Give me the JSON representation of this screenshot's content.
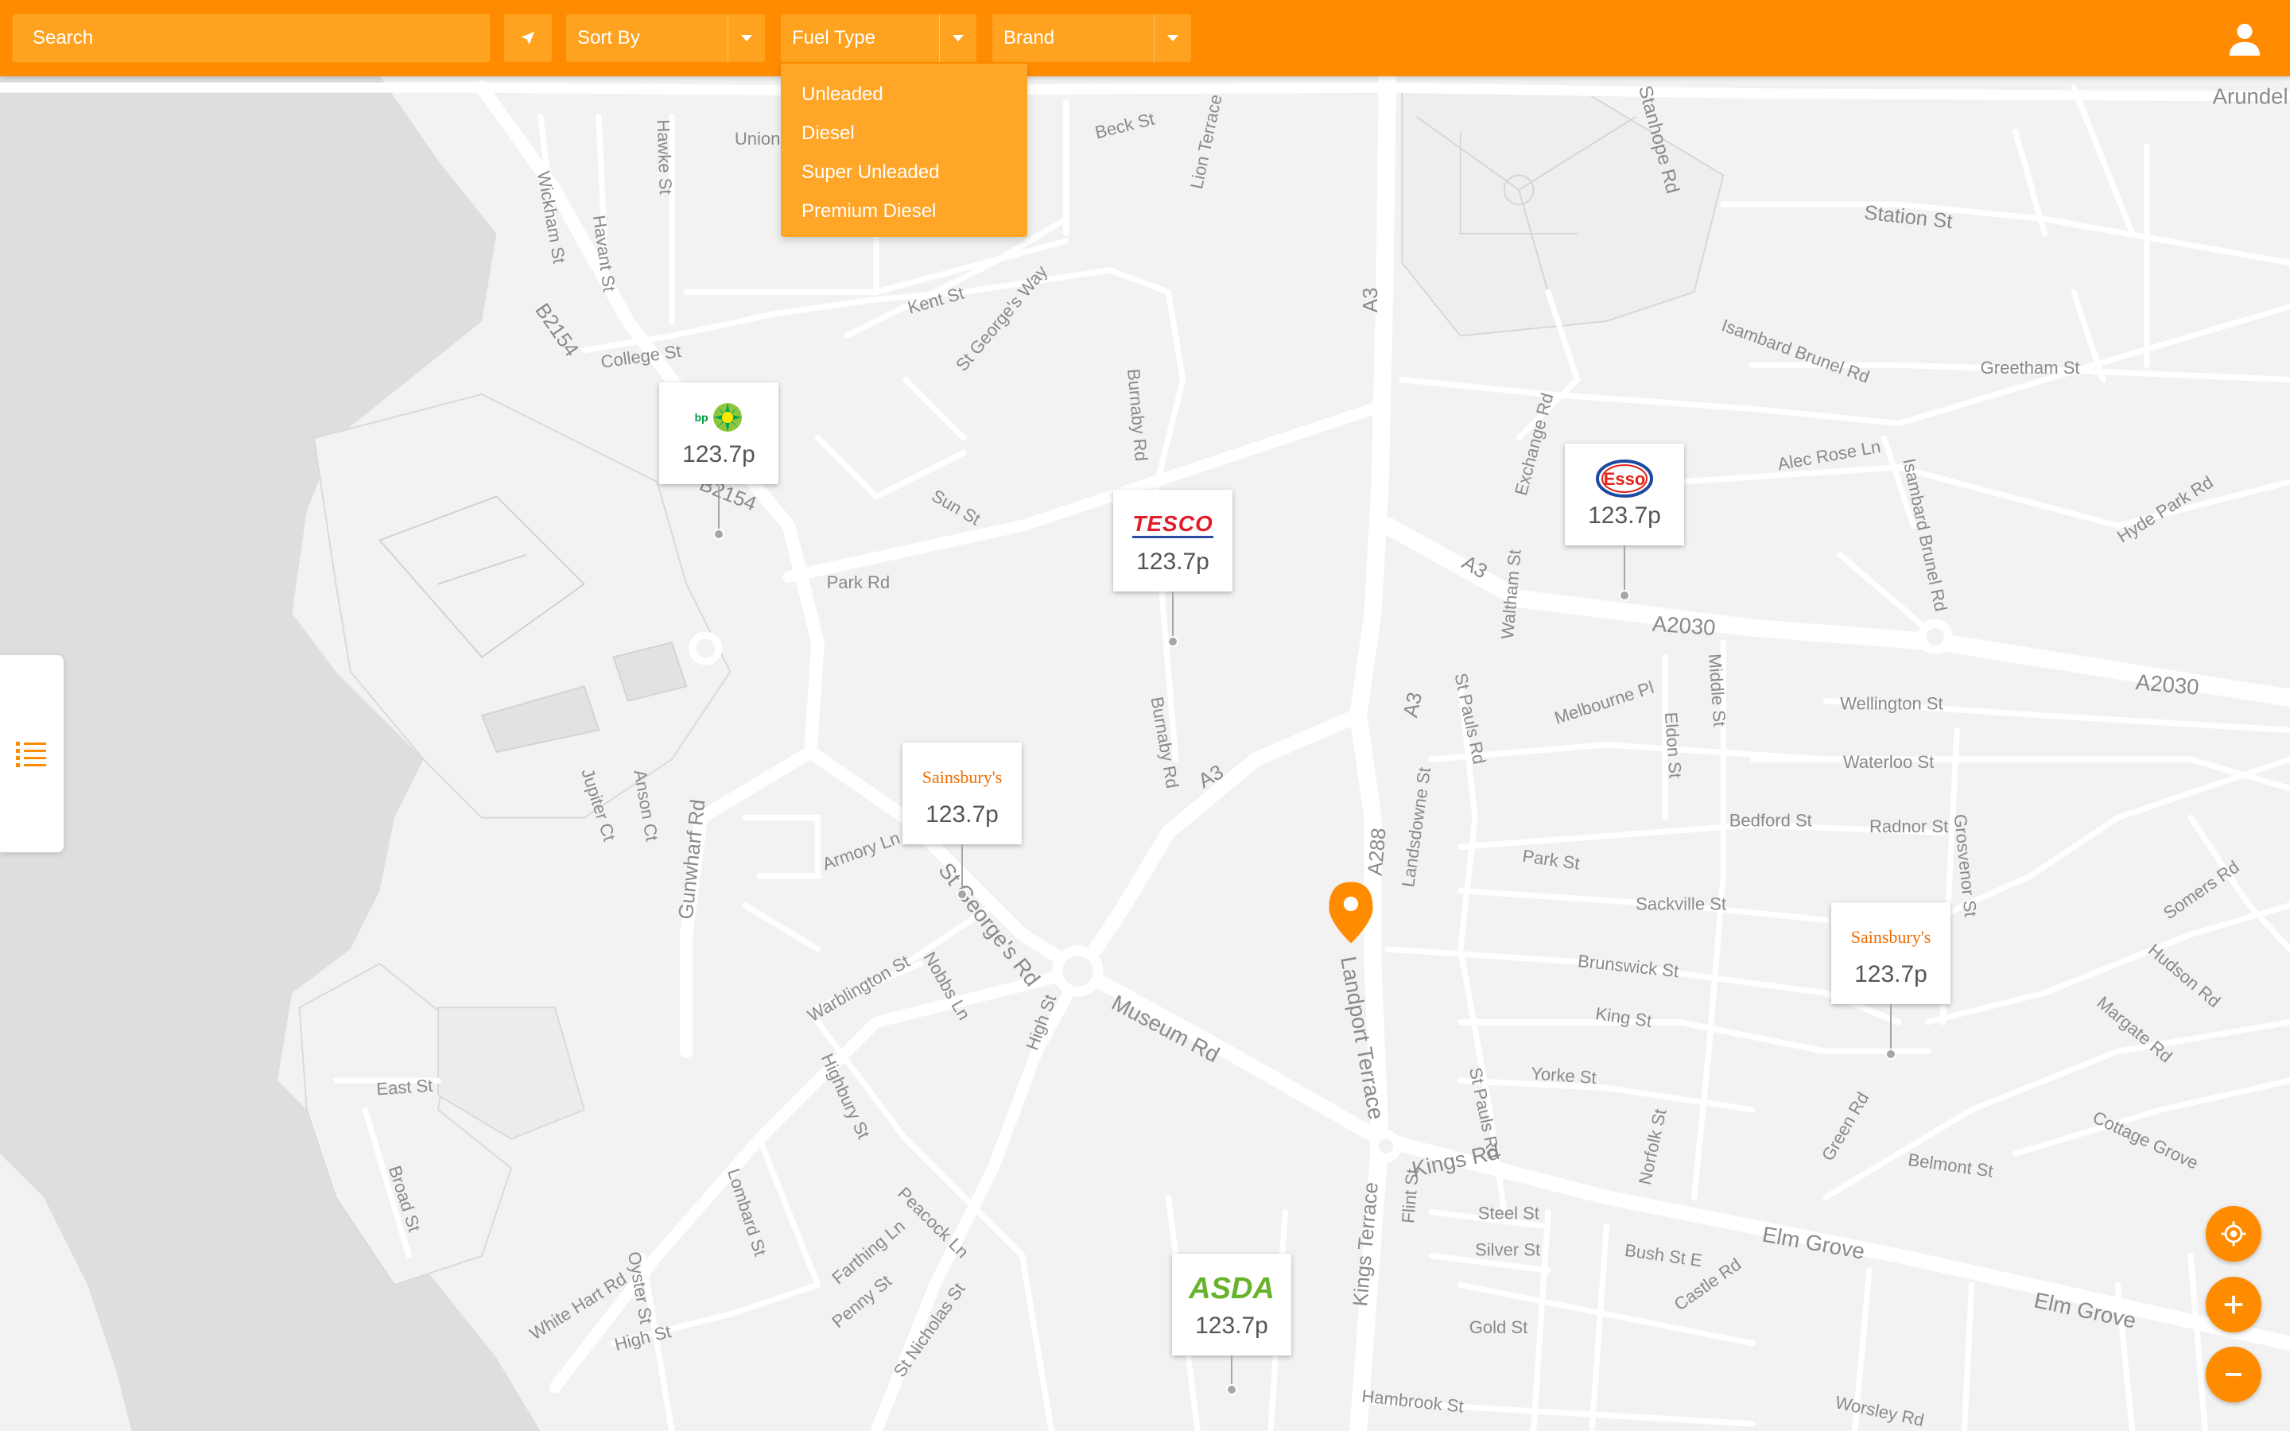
{
  "search": {
    "placeholder": "Search"
  },
  "filters": {
    "sort_by": {
      "label": "Sort By"
    },
    "fuel_type": {
      "label": "Fuel Type",
      "options": [
        "Unleaded",
        "Diesel",
        "Super Unleaded",
        "Premium Diesel"
      ]
    },
    "brand": {
      "label": "Brand"
    }
  },
  "markers": [
    {
      "brand": "bp",
      "price": "123.7p"
    },
    {
      "brand": "TESCO",
      "price": "123.7p"
    },
    {
      "brand": "Esso",
      "price": "123.7p"
    },
    {
      "brand": "Sainsbury's",
      "price": "123.7p"
    },
    {
      "brand": "Sainsbury's",
      "price": "123.7p"
    },
    {
      "brand": "ASDA",
      "price": "123.7p"
    }
  ],
  "map": {
    "street_labels": {
      "arundel": "Arundel",
      "station_st": "Station St",
      "stanhope_rd": "Stanhope Rd",
      "union": "Union",
      "beck_st": "Beck St",
      "lion_terrace": "Lion Terrace",
      "kent_st": "Kent St",
      "st_georges_way": "St George's Way",
      "college_st": "College St",
      "b2154_a": "B2154",
      "b2154_b": "B2154",
      "park_rd": "Park Rd",
      "sun_st": "Sun St",
      "burnaby_rd_a": "Burnaby Rd",
      "burnaby_rd_b": "Burnaby Rd",
      "greetham_st": "Greetham St",
      "isambard_brunel_rd_a": "Isambard Brunel Rd",
      "isambard_brunel_rd_b": "Isambard Brunel Rd",
      "alec_rose_ln": "Alec Rose Ln",
      "hyde_park_rd": "Hyde Park Rd",
      "exchange_rd": "Exchange Rd",
      "a3_a": "A3",
      "a3_b": "A3",
      "a3_c": "A3",
      "a3_d": "A3",
      "a2030_a": "A2030",
      "a2030_b": "A2030",
      "wellington_st": "Wellington St",
      "waterloo_st": "Waterloo St",
      "radnor_st": "Radnor St",
      "bedford_st": "Bedford St",
      "melbourne_pl": "Melbourne Pl",
      "st_pauls_rd_a": "St Pauls Rd",
      "st_pauls_rd_b": "St Pauls Rd",
      "landsdowne_st": "Landsdowne St",
      "park_st": "Park St",
      "sackville_st": "Sackville St",
      "brunswick_st": "Brunswick St",
      "king_st": "King St",
      "yorke_st": "Yorke St",
      "a288": "A288",
      "landport_terrace": "Landport Terrace",
      "kings_rd": "Kings Rd",
      "kings_terrace": "Kings Terrace",
      "elm_grove_a": "Elm Grove",
      "elm_grove_b": "Elm Grove",
      "museum_rd": "Museum Rd",
      "st_georges_rd": "St George's Rd",
      "armory_ln": "Armory Ln",
      "gunwharf_rd": "Gunwharf Rd",
      "jupiter_ct": "Jupiter Ct",
      "anson_ct": "Anson Ct",
      "warblington_st": "Warblington St",
      "nobbs_ln": "Nobbs Ln",
      "high_st_a": "High St",
      "high_st_b": "High St",
      "highbury_st": "Highbury St",
      "lombard_st": "Lombard St",
      "peacock_ln": "Peacock Ln",
      "farthing_ln": "Farthing Ln",
      "penny_st": "Penny St",
      "st_nicholas_st": "St Nicholas St",
      "east_st": "East St",
      "broad_st": "Broad St",
      "white_hart_rd": "White Hart Rd",
      "oyster_st": "Oyster St",
      "steel_st": "Steel St",
      "silver_st": "Silver St",
      "gold_st": "Gold St",
      "flint_st": "Flint St",
      "bush_st_e": "Bush St E",
      "castle_rd": "Castle Rd",
      "norfolk_st": "Norfolk St",
      "belmont_st": "Belmont St",
      "green_rd": "Green Rd",
      "cottage_grove": "Cottage Grove",
      "margate_rd": "Margate Rd",
      "hudson_rd": "Hudson Rd",
      "somers_rd": "Somers Rd",
      "wickham_st": "Wickham St",
      "havant_st": "Havant St",
      "hawke_st": "Hawke St",
      "middle_st": "Middle St",
      "waltham_st": "Waltham St",
      "hambrook_st": "Hambrook St",
      "worsley_rd": "Worsley Rd",
      "eldon_st": "Eldon St",
      "grosvenor_st": "Grosvenor St"
    }
  }
}
